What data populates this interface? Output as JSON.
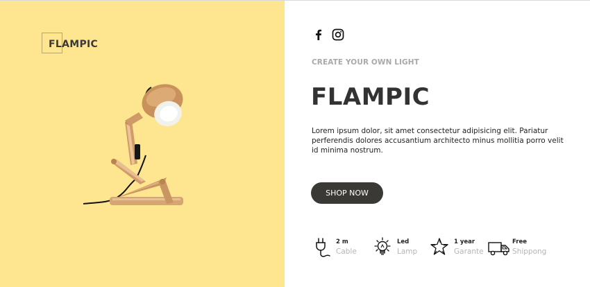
{
  "brand": {
    "logo_text": "FLAMPIC"
  },
  "hero": {
    "eyebrow": "CREATE YOUR OWN LIGHT",
    "title": "FLAMPIC",
    "description": "Lorem ipsum dolor, sit amet consectetur adipisicing elit. Pariatur perferendis dolores accusantium architecto minus mollitia porro velit id minima nostrum.",
    "cta_label": "SHOP NOW"
  },
  "social": {
    "icons": [
      "facebook-icon",
      "instagram-icon"
    ]
  },
  "features": [
    {
      "icon": "plug-icon",
      "title": "2 m",
      "subtitle": "Cable"
    },
    {
      "icon": "lightbulb-icon",
      "title": "Led",
      "subtitle": "Lamp"
    },
    {
      "icon": "star-icon",
      "title": "1 year",
      "subtitle": "Garante"
    },
    {
      "icon": "truck-icon",
      "title": "Free",
      "subtitle": "Shippong"
    }
  ],
  "colors": {
    "left_panel_bg": "#fde68f",
    "button_bg": "#3b3935",
    "text_dark": "#333333",
    "text_muted": "#a9a9a9"
  }
}
